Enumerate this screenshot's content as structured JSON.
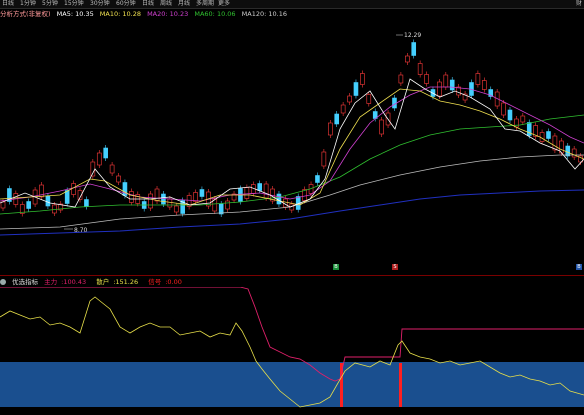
{
  "toolbar": {
    "items": [
      "日线",
      "1分钟",
      "5分钟",
      "15分钟",
      "30分钟",
      "60分钟",
      "日线",
      "周线",
      "月线",
      "多周期",
      "更多"
    ],
    "right_label": "财"
  },
  "ma_bar": {
    "indicator_name": "分析方式(非复权)",
    "ma5": "MA5: 10.35",
    "ma10": "MA10: 10.28",
    "ma20": "MA20: 10.23",
    "ma60": "MA60: 10.06",
    "ma120": "MA120: 10.16"
  },
  "price_annotations": {
    "high": "12.29",
    "low": "8.70"
  },
  "indicator_bar": {
    "name": "优选指标",
    "main_label": "主力",
    "main_value": "100.43",
    "retail_label": "散户",
    "retail_value": "151.26",
    "signal_label": "信号",
    "signal_value": "0.00"
  },
  "markers": [
    {
      "label": "B",
      "color": "#1a8f3a"
    },
    {
      "label": "S",
      "color": "#b02020"
    },
    {
      "label": "B",
      "color": "#2255aa"
    }
  ],
  "colors": {
    "up": "#ff3b3b",
    "down": "#45d0ff",
    "ma5": "#ffffff",
    "ma10": "#f0e050",
    "ma20": "#d040d0",
    "ma60": "#30c030",
    "ma120": "#cccccc",
    "ma250": "#2030c0",
    "ind_yellow": "#e8e04a",
    "ind_pink": "#e0206a",
    "band": "#1a4f8f",
    "signal": "#ff2020"
  }
}
